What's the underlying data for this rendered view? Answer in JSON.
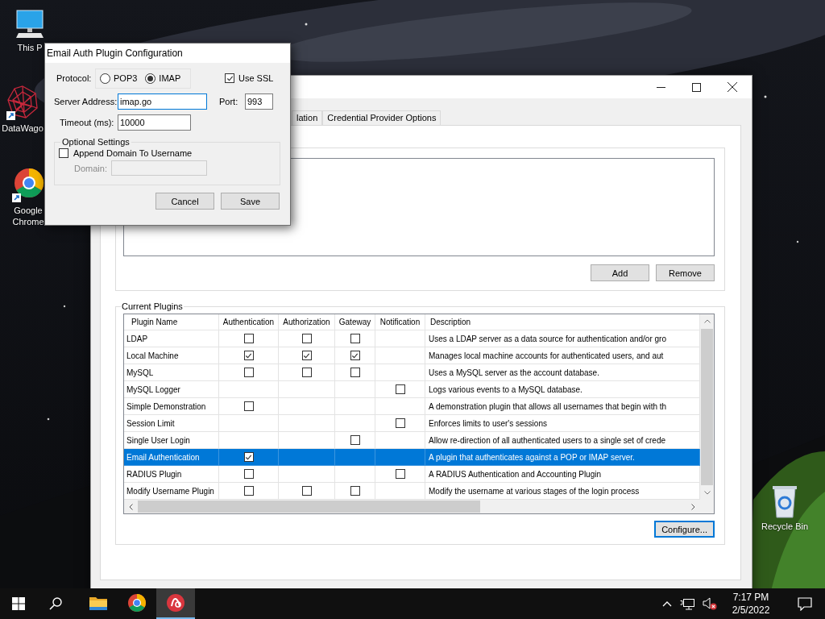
{
  "desktop": {
    "icons": [
      {
        "label": "This P",
        "kind": "computer"
      },
      {
        "label": "DataWago",
        "kind": "web"
      },
      {
        "label": "Google Chrome",
        "kind": "browser"
      }
    ],
    "recycle_bin": {
      "label": "Recycle Bin"
    }
  },
  "main_window": {
    "tabs": [
      {
        "label": "lation",
        "selected": false
      },
      {
        "label": "Credential Provider Options",
        "selected": false
      }
    ],
    "add_button": "Add",
    "remove_button": "Remove",
    "plugins": {
      "title": "Current Plugins",
      "columns": [
        "Plugin Name",
        "Authentication",
        "Authorization",
        "Gateway",
        "Notification",
        "Description"
      ],
      "rows": [
        {
          "name": "LDAP",
          "authentication": false,
          "authorization": false,
          "gateway": false,
          "description": "Uses a LDAP server as a data source for authentication and/or gro",
          "selected": false
        },
        {
          "name": "Local Machine",
          "authentication": true,
          "authorization": true,
          "gateway": true,
          "description": "Manages local machine accounts for authenticated users, and aut",
          "selected": false
        },
        {
          "name": "MySQL",
          "authentication": false,
          "authorization": false,
          "gateway": false,
          "description": "Uses a MySQL server as the account database.",
          "selected": false
        },
        {
          "name": "MySQL Logger",
          "notification": false,
          "description": "Logs various events to a MySQL database.",
          "selected": false
        },
        {
          "name": "Simple Demonstration",
          "authentication": false,
          "description": "A demonstration plugin that allows all usernames that begin with th",
          "selected": false
        },
        {
          "name": "Session Limit",
          "notification": false,
          "description": "Enforces limits to user's sessions",
          "selected": false
        },
        {
          "name": "Single User Login",
          "gateway": false,
          "description": "Allow re-direction of all authenticated users to a single set of crede",
          "selected": false
        },
        {
          "name": "Email Authentication",
          "authentication": true,
          "description": "A plugin that authenticates against a POP or IMAP server.",
          "selected": true
        },
        {
          "name": "RADIUS Plugin",
          "authentication": false,
          "notification": false,
          "description": "A RADIUS Authentication and Accounting Plugin",
          "selected": false
        },
        {
          "name": "Modify Username Plugin",
          "authentication": false,
          "authorization": false,
          "gateway": false,
          "description": "Modify the username at various stages of the login process",
          "selected": false
        }
      ]
    },
    "configure_button": "Configure..."
  },
  "dialog": {
    "title": "Email Auth Plugin Configuration",
    "protocol_label": "Protocol:",
    "protocols": [
      {
        "label": "POP3",
        "selected": false
      },
      {
        "label": "IMAP",
        "selected": true
      }
    ],
    "use_ssl": {
      "label": "Use SSL",
      "checked": true
    },
    "server_address": {
      "label": "Server Address:",
      "value": "imap.go"
    },
    "port": {
      "label": "Port:",
      "value": "993"
    },
    "timeout": {
      "label": "Timeout (ms):",
      "value": "10000"
    },
    "optional_settings": {
      "title": "Optional Settings",
      "append_domain": {
        "label": "Append Domain To Username",
        "checked": false
      },
      "domain": {
        "label": "Domain:",
        "disabled": true
      }
    },
    "buttons": [
      "Cancel",
      "Save"
    ]
  },
  "taskbar": {
    "apps": [
      {
        "kind": "folder",
        "active": false
      },
      {
        "kind": "browser",
        "active": false
      },
      {
        "kind": "app",
        "active": true
      }
    ],
    "time": "7:17 PM",
    "date": "2/5/2022"
  }
}
